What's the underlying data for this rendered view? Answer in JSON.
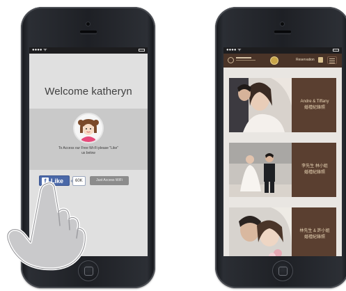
{
  "left_phone": {
    "status": {
      "carrier": "●●●● ᯤ"
    },
    "welcome_title": "Welcome katheryn",
    "access_message_line1": "To Access our Free Wi-Fi please \"Like\"",
    "access_message_line2": "us below",
    "like_button_label": "Like",
    "like_count": "60K",
    "just_access_label": "Just Access WiFi",
    "icons": {
      "facebook": "facebook-f-icon",
      "avatar": "cartoon-girl-avatar"
    }
  },
  "right_phone": {
    "status": {
      "carrier": "●●●● ᯤ"
    },
    "header": {
      "reservation_label": "Reservation",
      "icons": [
        "logo-mark",
        "ring-icon",
        "calendar-icon",
        "menu-icon"
      ]
    },
    "cards": [
      {
        "line1": "Andre & Tiffany",
        "line2": "婚禮紀錄照"
      },
      {
        "line1": "李先生 林小姐",
        "line2": "婚禮紀錄照"
      },
      {
        "line1": "林先生 & 許小姐",
        "line2": "婚禮紀錄照"
      }
    ]
  },
  "colors": {
    "facebook_blue": "#4a68a8",
    "brown_header": "#4a3428",
    "card_brown": "#5a3f30",
    "phone_black": "#1e2025"
  }
}
